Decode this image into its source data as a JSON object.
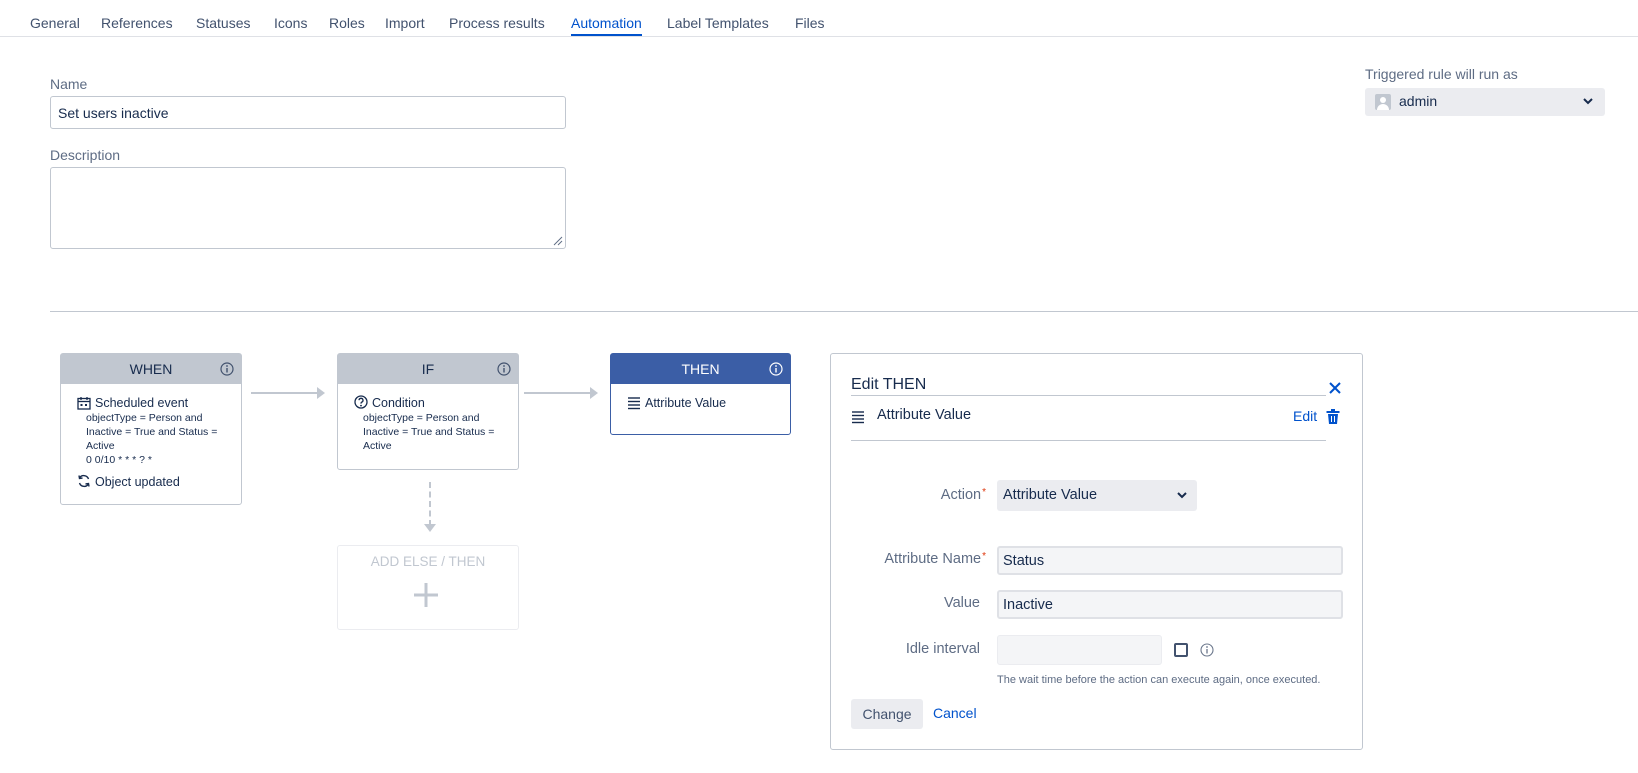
{
  "tabs": [
    {
      "label": "General"
    },
    {
      "label": "References"
    },
    {
      "label": "Statuses"
    },
    {
      "label": "Icons"
    },
    {
      "label": "Roles"
    },
    {
      "label": "Import"
    },
    {
      "label": "Process results"
    },
    {
      "label": "Automation",
      "active": true
    },
    {
      "label": "Label Templates"
    },
    {
      "label": "Files"
    }
  ],
  "form": {
    "name_label": "Name",
    "name_value": "Set users inactive",
    "description_label": "Description",
    "description_value": ""
  },
  "run_as": {
    "label": "Triggered rule will run as",
    "user": "admin"
  },
  "flow": {
    "when": {
      "title": "WHEN",
      "event": "Scheduled event",
      "detail_1": "objectType = Person and",
      "detail_2": "Inactive = True and Status =",
      "detail_3": "Active",
      "schedule": "0 0/10 * * * ? *",
      "trigger_2": "Object updated"
    },
    "if": {
      "title": "IF",
      "condition": "Condition",
      "detail_1": "objectType = Person and",
      "detail_2": "Inactive = True and Status =",
      "detail_3": "Active"
    },
    "then": {
      "title": "THEN",
      "action": "Attribute Value"
    },
    "add_else_then": "ADD ELSE / THEN"
  },
  "edit_panel": {
    "title": "Edit THEN",
    "action_row": "Attribute Value",
    "edit_link": "Edit",
    "action_label": "Action",
    "action_value": "Attribute Value",
    "attribute_name_label": "Attribute Name",
    "attribute_name_value": "Status",
    "value_label": "Value",
    "value_value": "Inactive",
    "idle_label": "Idle interval",
    "idle_value": "",
    "idle_help": "The wait time before the action can execute again, once executed.",
    "change_button": "Change",
    "cancel_link": "Cancel"
  },
  "colors": {
    "accent": "#0052cc",
    "then_header": "#3b5ea6",
    "box_header": "#c1c7d0",
    "required": "#de350b"
  }
}
